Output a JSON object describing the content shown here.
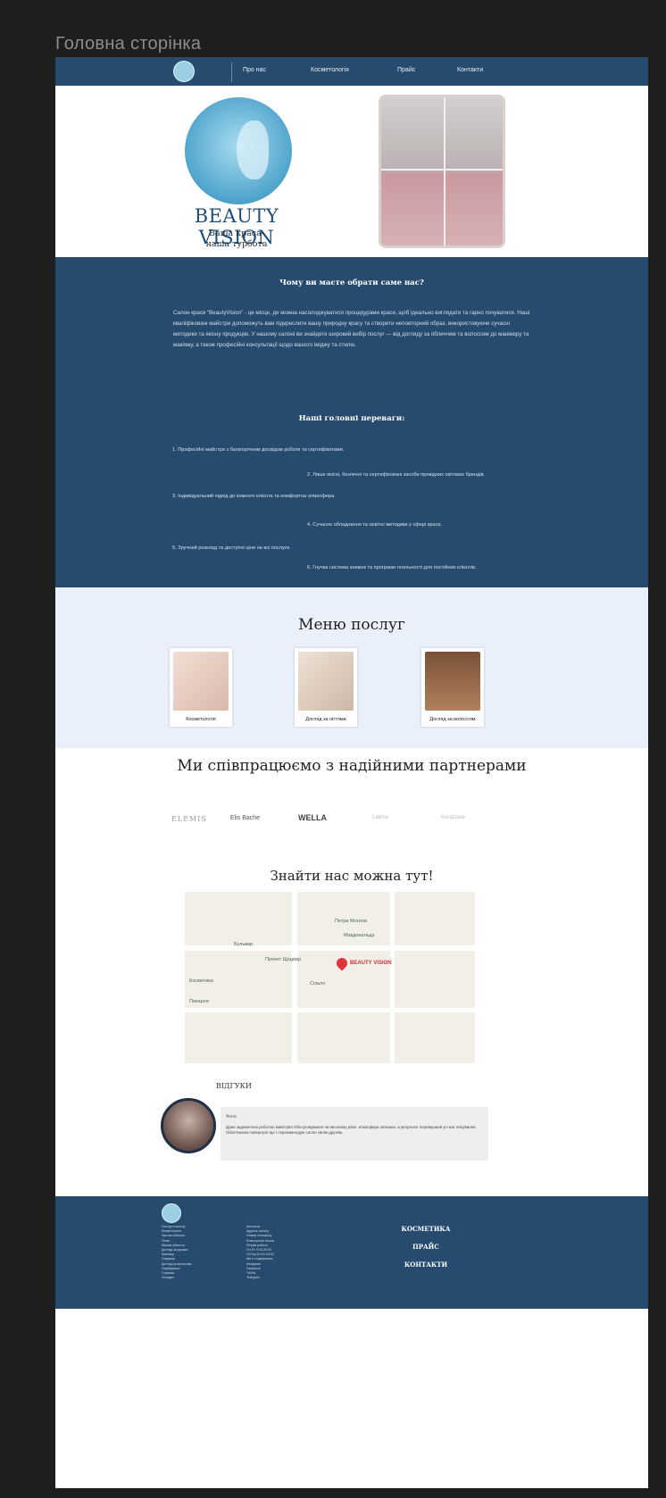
{
  "frame_title": "Головна сторінка",
  "nav": {
    "items": [
      "Про нас",
      "Косметологія",
      "Прайс",
      "Контакти"
    ]
  },
  "hero": {
    "brand": "BEAUTY VISION",
    "slogan": "Ваша краса-\nнаша турбота"
  },
  "about": {
    "heading": "Чому ви маєте обрати саме нас?",
    "text": "Салон краси “BeautyVision” - це місце, де можна насолоджуватися процедурами краси, щоб ідеально виглядати та гарно почуватися. Наші кваліфіковані майстри допоможуть вам підкреслити вашу природну красу та створити неповторний образ, використовуючи сучасні методики та якісну продукцію. У нашому салоні ви знайдете широкий вибір послуг — від догляду за обличчям та волоссям до манікюру та макіяжу, а також професійні консультації щодо вашого іміджу та стилю.",
    "adv_heading": "Наші головні переваги:",
    "advantages": [
      "1. Професійні майстри з багаторічним досвідом роботи та сертифікатами.",
      "2. Лише якісні, безпечні та сертифіковані засоби провідних світових брендів.",
      "3. Індивідуальний підхід до кожного клієнта та комфортна атмосфера.",
      "4. Сучасне обладнання та новітні методики у сфері краси.",
      "5. Зручний розклад та доступні ціни на всі послуги.",
      "6. Гнучка система знижок та програми лояльності для постійних клієнтів."
    ]
  },
  "services": {
    "title": "Меню послуг",
    "items": [
      "Косметологія",
      "Догляд за нігтями",
      "Догляд за волоссям"
    ]
  },
  "partners": {
    "title": "Ми співпрацюємо з надійними партнерами",
    "logos": [
      "ELEMIS",
      "Elis Bache",
      "WELLA",
      "Lakme",
      "Kerastase"
    ]
  },
  "map": {
    "title": "Знайти нас можна тут!",
    "pin_label": "BEAUTY VISION",
    "labels": [
      "Петра Могили",
      "Макдональдз",
      "Бульвар",
      "Проект Щедевр",
      "Сільпо",
      "Косметика",
      "Пекарня"
    ]
  },
  "reviews": {
    "title": "ВІДГУКИ",
    "name": "Анна",
    "text": "Дуже задоволена роботою майстрів! Обслуговування на високому рівні, атмосфера затишна, а результат перевершив усі мої очікування. Обов’язково повернуся ще і порекомендую салон своїм друзям."
  },
  "footer": {
    "col1": "Послуги салону\nКосметологія\nЧистка обличчя\nПілінг\nМасаж обличчя\nДогляд за руками\nМанікюр\nПедикюр\nДогляд за волоссям\nФарбування\nСтрижка\nУкладка",
    "col2": "Контакти\nАдреса салону\nНомер телефону\nЕлектронна пошта\nРежим роботи\nПн-Пт 9:00-20:00\nСб-Нд 10:00-18:00\nМи в соцмережах\nInstagram\nFacebook\nTikTok\nTelegram",
    "links": [
      "КОСМЕТИКА",
      "ПРАЙС",
      "КОНТАКТИ"
    ]
  },
  "colors": {
    "primary": "#264b6e",
    "menu_bg": "#eaf0fb",
    "accent": "#d73137"
  }
}
